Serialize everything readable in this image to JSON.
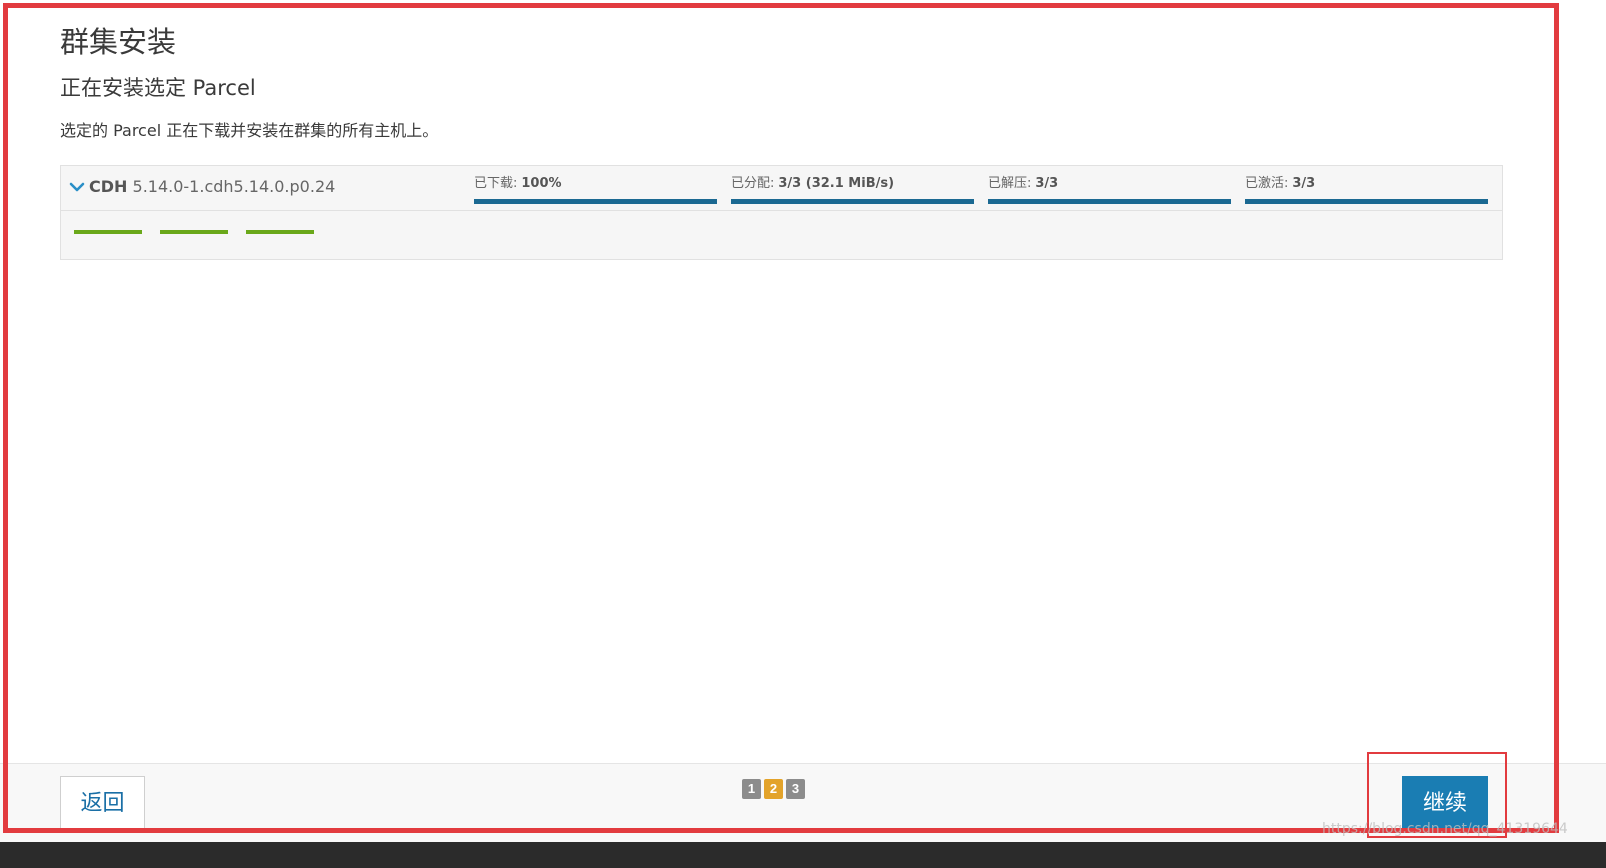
{
  "page": {
    "title": "群集安装",
    "subtitle": "正在安装选定 Parcel",
    "description": "选定的 Parcel 正在下载并安装在群集的所有主机上。"
  },
  "parcel": {
    "product": "CDH",
    "version": "5.14.0-1.cdh5.14.0.p0.24",
    "stages": [
      {
        "label": "已下载:",
        "value": "100%",
        "progress": 1.0
      },
      {
        "label": "已分配:",
        "value": "3/3 (32.1 MiB/s)",
        "progress": 1.0
      },
      {
        "label": "已解压:",
        "value": "3/3",
        "progress": 1.0
      },
      {
        "label": "已激活:",
        "value": "3/3",
        "progress": 1.0
      }
    ],
    "hosts_complete": 3
  },
  "footer": {
    "back_label": "返回",
    "continue_label": "继续",
    "steps": [
      "1",
      "2",
      "3"
    ],
    "current_step": 2
  },
  "watermark": "https://blog.csdn.net/qq_41319644",
  "colors": {
    "accent": "#1a7db3",
    "progress": "#1b6992",
    "host_ok": "#6aa81a",
    "step_current": "#e3a32a",
    "step_other": "#8c8c8c",
    "highlight": "#e23b3f"
  }
}
